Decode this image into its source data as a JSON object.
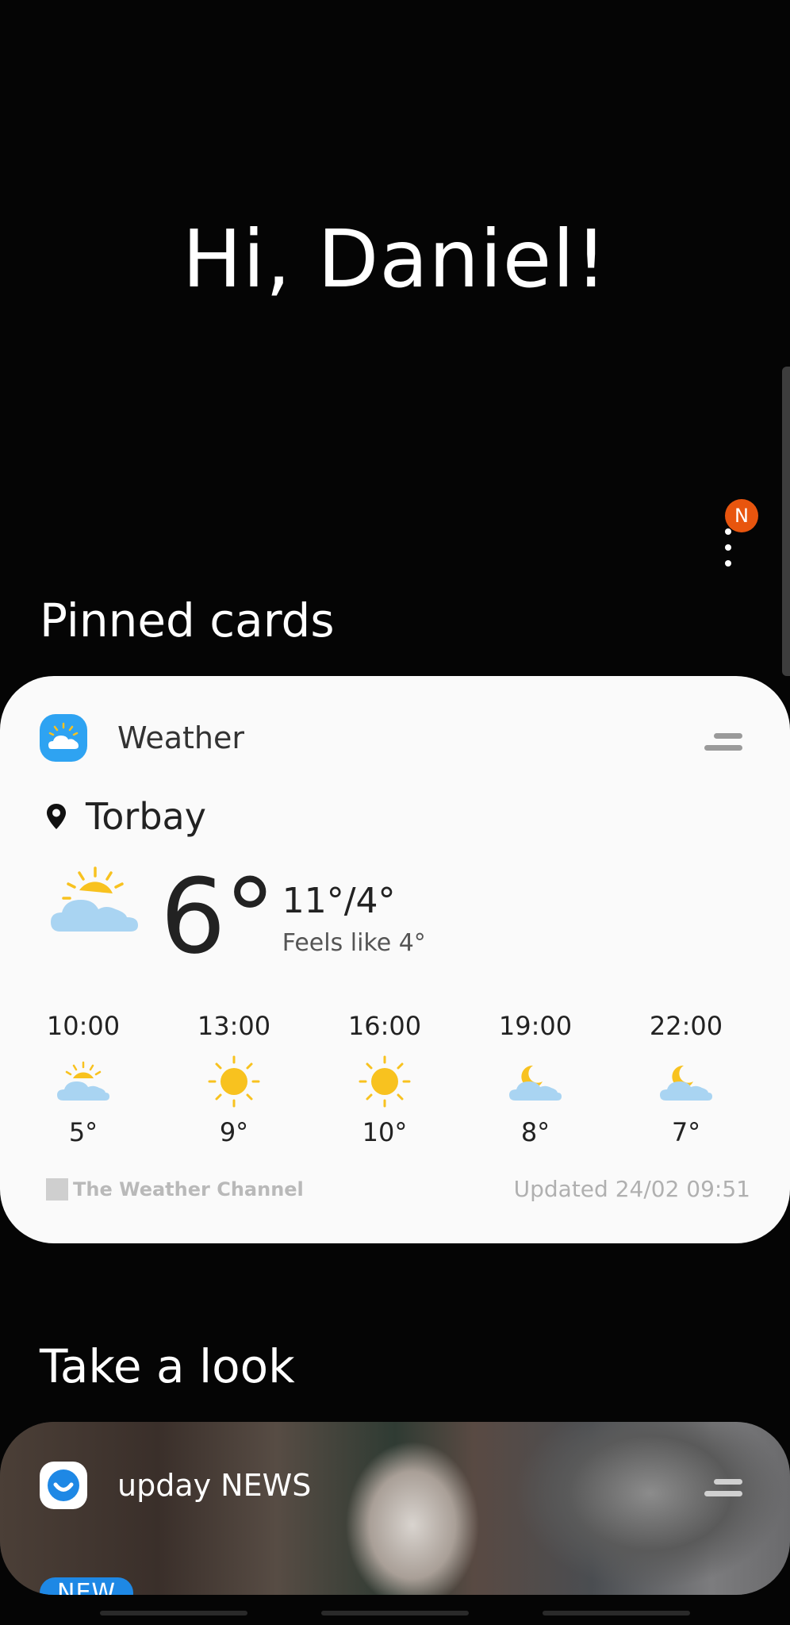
{
  "greeting": "Hi, Daniel!",
  "notification_badge": "N",
  "pinned": {
    "title": "Pinned cards",
    "weather_card": {
      "app_name": "Weather",
      "location": "Torbay",
      "current_temp": "6°",
      "range": "11°/4°",
      "feels_like": "Feels like 4°",
      "hourly": [
        {
          "time": "10:00",
          "icon": "partly-sunny-icon",
          "temp": "5°"
        },
        {
          "time": "13:00",
          "icon": "sun-icon",
          "temp": "9°"
        },
        {
          "time": "16:00",
          "icon": "sun-icon",
          "temp": "10°"
        },
        {
          "time": "19:00",
          "icon": "moon-cloud-icon",
          "temp": "8°"
        },
        {
          "time": "22:00",
          "icon": "moon-cloud-icon",
          "temp": "7°"
        }
      ],
      "source": "The Weather Channel",
      "updated": "Updated 24/02 09:51"
    }
  },
  "take_a_look": {
    "title": "Take a look",
    "news_card": {
      "app_name": "upday NEWS",
      "badge": "NEW"
    }
  },
  "colors": {
    "background": "#050505",
    "card": "#fafafa",
    "weather_icon_bg": "#2ea3f2",
    "badge": "#e8550e",
    "sun": "#f8c21f",
    "cloud": "#a9d4f2"
  }
}
